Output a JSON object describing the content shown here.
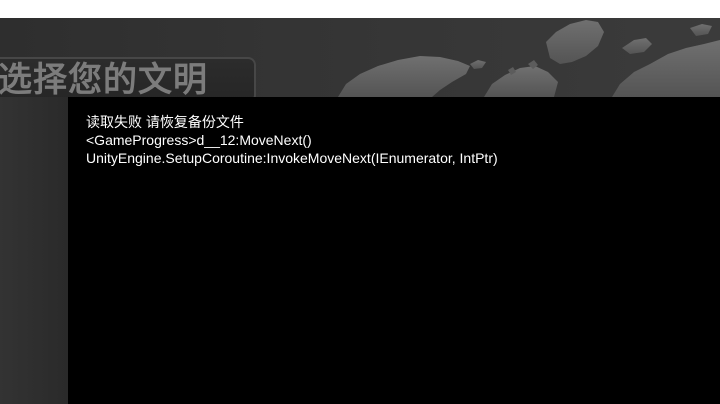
{
  "screen": {
    "title": "选择您的文明"
  },
  "error": {
    "lines": [
      "读取失败 请恢复备份文件",
      "<GameProgress>d__12:MoveNext()",
      "UnityEngine.SetupCoroutine:InvokeMoveNext(IEnumerator, IntPtr)"
    ]
  },
  "colors": {
    "background": "#343434",
    "map_land": "#626262",
    "title_text": "#7c7c7c",
    "overlay": "#000000",
    "overlay_text": "#ffffff"
  },
  "icons": {
    "background_art": "world-map-icon"
  }
}
